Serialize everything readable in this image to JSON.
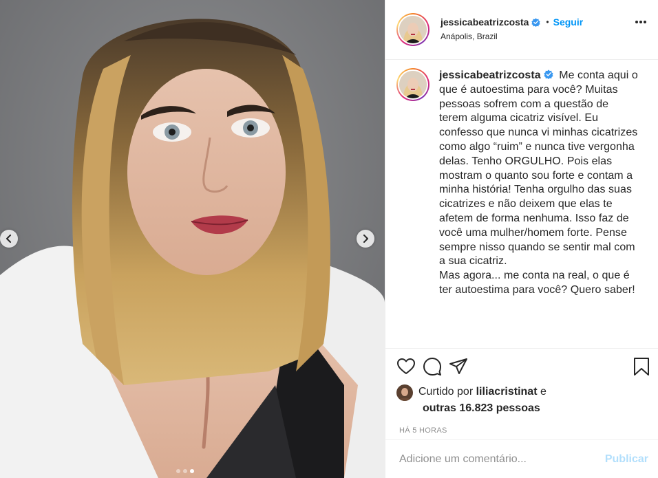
{
  "post": {
    "username": "jessicabeatrizcosta",
    "follow_label": "Seguir",
    "separator": "•",
    "location": "Anápolis, Brazil",
    "caption": "Me conta aqui o que é autoestima para você? Muitas pessoas sofrem com a questão de terem alguma cicatriz visível. Eu confesso que nunca vi minhas cicatrizes como algo “ruim” e nunca tive vergonha delas. Tenho ORGULHO. Pois elas mostram o quanto sou forte e contam a minha história! Tenha orgulho das suas cicatrizes e não deixem que elas te afetem de forma nenhuma. Isso faz de você uma mulher/homem forte. Pense sempre nisso quando se sentir mal com a sua cicatriz.\nMas agora... me conta na real, o que é ter autoestima para você? Quero saber!"
  },
  "likes": {
    "prefix": "Curtido por",
    "liked_by": "liliacristinat",
    "conj": "e",
    "others": "outras 16.823 pessoas"
  },
  "time_ago": "HÁ 5 HORAS",
  "comment_box": {
    "placeholder": "Adicione um comentário...",
    "publish_label": "Publicar"
  },
  "carousel": {
    "total": 3,
    "active_index": 2
  },
  "colors": {
    "link_blue": "#0095f6",
    "publish_disabled": "#b2dffc",
    "verified_blue": "#3897f0",
    "muted": "#8e8e8e"
  },
  "icons": [
    "chevron-left-icon",
    "chevron-right-icon",
    "verified-badge-icon",
    "more-options-icon",
    "heart-icon",
    "comment-icon",
    "share-icon",
    "bookmark-icon"
  ]
}
